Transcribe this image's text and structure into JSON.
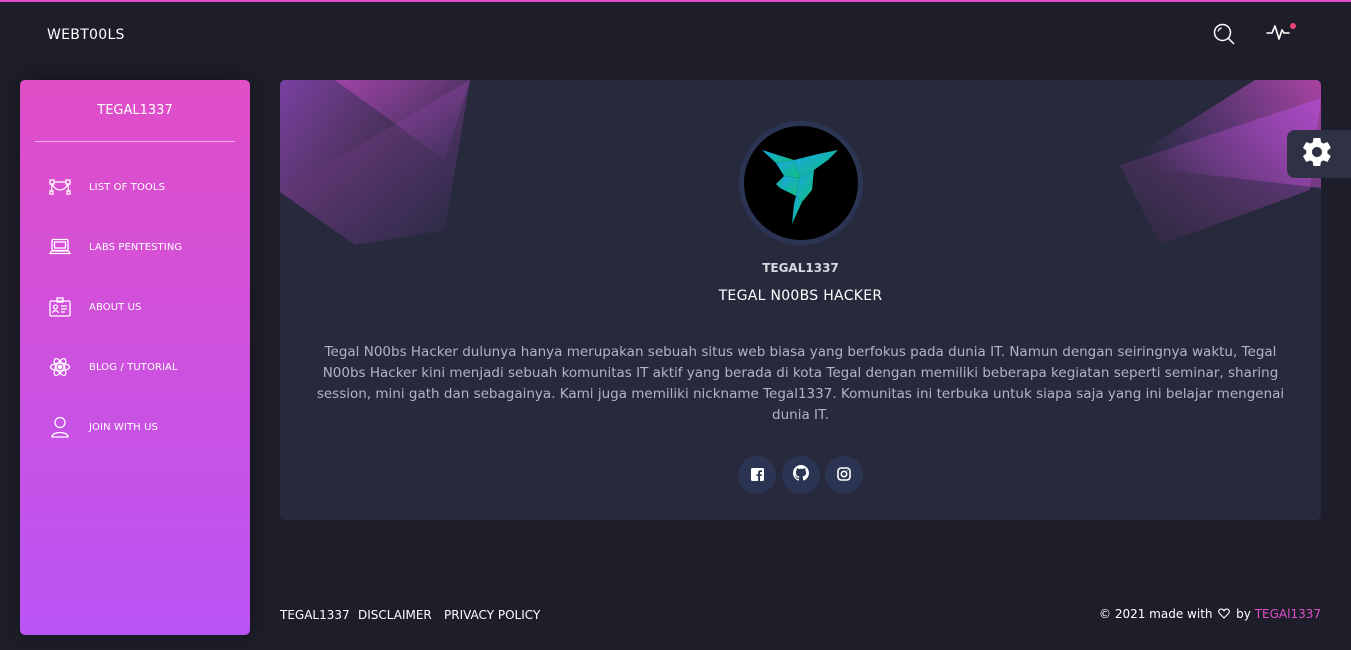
{
  "brand": "WEBT00LS",
  "navbar": {
    "search_icon": "search-icon",
    "activity_icon": "activity-icon",
    "notification_color": "#ec407a"
  },
  "sidebar": {
    "title": "TEGAL1337",
    "items": [
      {
        "label": "LIST OF TOOLS",
        "icon": "vector-path-icon"
      },
      {
        "label": "LABS PENTESTING",
        "icon": "laptop-icon"
      },
      {
        "label": "ABOUT US",
        "icon": "id-card-icon"
      },
      {
        "label": "BLOG / TUTORIAL",
        "icon": "atom-icon"
      },
      {
        "label": "JOIN WITH US",
        "icon": "user-icon"
      }
    ],
    "gradient": [
      "#e14ec7",
      "#ba54f5"
    ]
  },
  "profile": {
    "username": "TEGAL1337",
    "subtitle": "TEGAL N00BS HACKER",
    "description": "Tegal N00bs Hacker dulunya hanya merupakan sebuah situs web biasa yang berfokus pada dunia IT. Namun dengan seiringnya waktu, Tegal N00bs Hacker kini menjadi sebuah komunitas IT aktif yang berada di kota Tegal dengan memiliki beberapa kegiatan seperti seminar, sharing session, mini gath dan sebagainya. Kami juga memiliki nickname Tegal1337. Komunitas ini terbuka untuk siapa saja yang ini belajar mengenai dunia IT.",
    "social": [
      "facebook-icon",
      "github-icon",
      "instagram-icon"
    ]
  },
  "settings_icon": "gear-icon",
  "footer": {
    "links": [
      "TEGAL1337",
      "DISCLAIMER",
      "PRIVACY POLICY"
    ],
    "copyright_prefix": "© 2021 made with",
    "copyright_by": "by",
    "copyright_author": "TEGAl1337",
    "accent": "#e14eca"
  }
}
